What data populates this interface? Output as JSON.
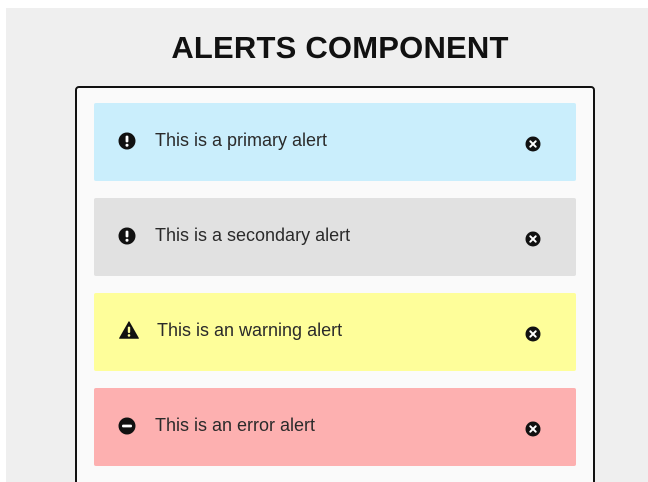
{
  "header": {
    "title": "ALERTS COMPONENT"
  },
  "alerts": [
    {
      "type": "primary",
      "text": "This is a primary alert",
      "icon": "exclamation-circle-icon",
      "background": "#caeefc"
    },
    {
      "type": "secondary",
      "text": "This is a secondary alert",
      "icon": "exclamation-circle-icon",
      "background": "#e1e1e1"
    },
    {
      "type": "warning",
      "text": "This is an warning alert",
      "icon": "warning-triangle-icon",
      "background": "#fefe9a"
    },
    {
      "type": "error",
      "text": "This is an error alert",
      "icon": "minus-circle-icon",
      "background": "#fdb0b0"
    }
  ],
  "colors": {
    "page_background": "#efefef",
    "panel_background": "#fafafa",
    "panel_border": "#111111",
    "icon": "#111111"
  }
}
